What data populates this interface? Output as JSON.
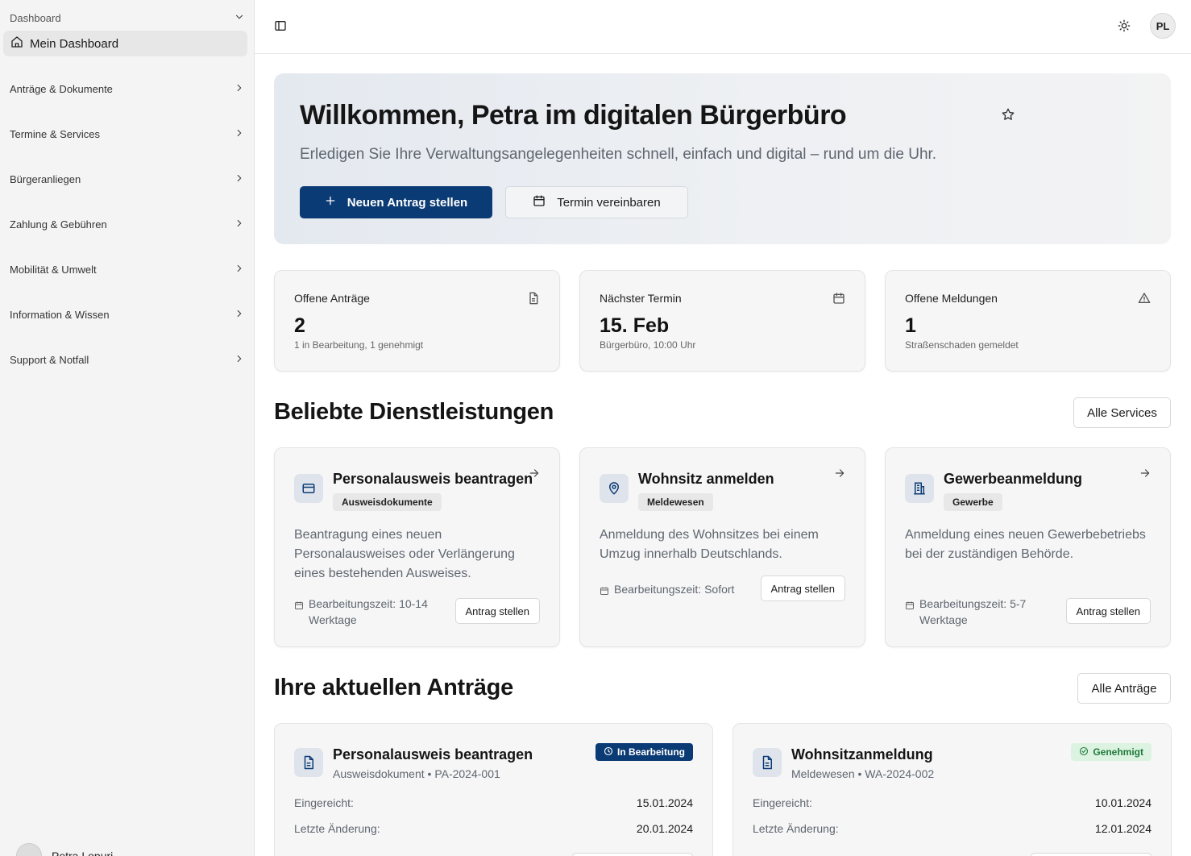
{
  "sidebar": {
    "group_label": "Dashboard",
    "active_item": "Mein Dashboard",
    "items": [
      {
        "label": "Anträge & Dokumente"
      },
      {
        "label": "Termine & Services"
      },
      {
        "label": "Bürgeranliegen"
      },
      {
        "label": "Zahlung & Gebühren"
      },
      {
        "label": "Mobilität & Umwelt"
      },
      {
        "label": "Information & Wissen"
      },
      {
        "label": "Support & Notfall"
      }
    ],
    "user_name": "Petra Lopuri"
  },
  "topbar": {
    "avatar_initials": "PL",
    "icons": [
      "sidebar-toggle-icon",
      "sun-icon"
    ]
  },
  "hero": {
    "title": "Willkommen, Petra im digitalen Bürgerbüro",
    "subtitle": "Erledigen Sie Ihre Verwaltungsangelegenheiten schnell, einfach und digital – rund um die Uhr.",
    "primary_button": "Neuen Antrag stellen",
    "secondary_button": "Termin vereinbaren"
  },
  "stats": [
    {
      "label": "Offene Anträge",
      "value": "2",
      "sub": "1 in Bearbeitung, 1 genehmigt",
      "icon": "document-icon"
    },
    {
      "label": "Nächster Termin",
      "value": "15. Feb",
      "sub": "Bürgerbüro, 10:00 Uhr",
      "icon": "calendar-icon"
    },
    {
      "label": "Offene Meldungen",
      "value": "1",
      "sub": "Straßenschaden gemeldet",
      "icon": "warning-icon"
    }
  ],
  "services_section": {
    "title": "Beliebte Dienstleistungen",
    "all_button": "Alle Services",
    "items": [
      {
        "name": "Personalausweis beantragen",
        "tag": "Ausweisdokumente",
        "description": "Beantragung eines neuen Personalausweises oder Verlängerung eines bestehenden Ausweises.",
        "time": "Bearbeitungszeit: 10-14 Werktage",
        "action": "Antrag stellen",
        "icon": "id-card-icon"
      },
      {
        "name": "Wohnsitz anmelden",
        "tag": "Meldewesen",
        "description": "Anmeldung des Wohnsitzes bei einem Umzug innerhalb Deutschlands.",
        "time": "Bearbeitungszeit: Sofort",
        "action": "Antrag stellen",
        "icon": "map-pin-icon"
      },
      {
        "name": "Gewerbeanmeldung",
        "tag": "Gewerbe",
        "description": "Anmeldung eines neuen Gewerbebetriebs bei der zuständigen Behörde.",
        "time": "Bearbeitungszeit: 5-7 Werktage",
        "action": "Antrag stellen",
        "icon": "building-icon"
      }
    ]
  },
  "applications_section": {
    "title": "Ihre aktuellen Anträge",
    "all_button": "Alle Anträge",
    "submitted_label": "Eingereicht:",
    "changed_label": "Letzte Änderung:",
    "items": [
      {
        "name": "Personalausweis beantragen",
        "category": "Ausweisdokument",
        "id": "PA-2024-001",
        "status": "In Bearbeitung",
        "status_color": "#0b3b74",
        "submitted": "15.01.2024",
        "changed": "20.01.2024"
      },
      {
        "name": "Wohnsitzanmeldung",
        "category": "Meldewesen",
        "id": "WA-2024-002",
        "status": "Genehmigt",
        "status_color": "#1f7a3a",
        "submitted": "10.01.2024",
        "changed": "12.01.2024"
      }
    ]
  },
  "colors": {
    "primary": "#0b3b74",
    "approved_bg": "#dcf3e2",
    "approved_fg": "#1f7a3a"
  }
}
